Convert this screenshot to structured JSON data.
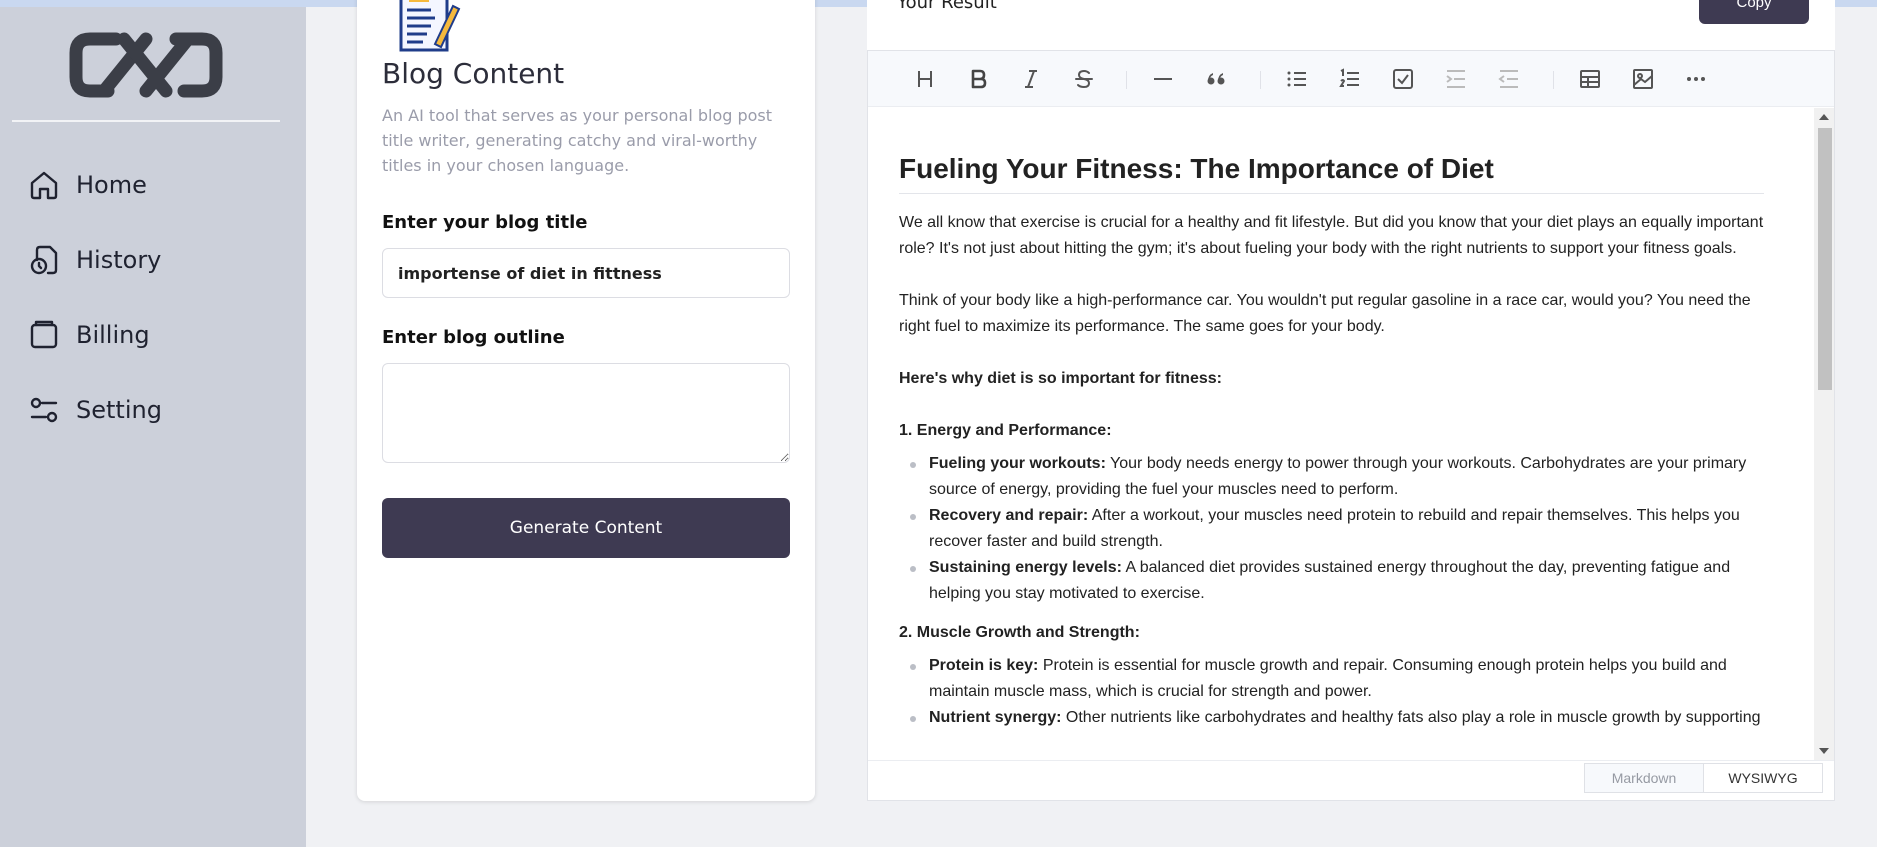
{
  "sidebar": {
    "logo_icon": "chain-link-logo",
    "items": [
      {
        "label": "Home",
        "icon": "home-icon"
      },
      {
        "label": "History",
        "icon": "history-icon"
      },
      {
        "label": "Billing",
        "icon": "wallet-icon"
      },
      {
        "label": "Setting",
        "icon": "sliders-icon"
      }
    ]
  },
  "form": {
    "icon": "blog-writing-icon",
    "title": "Blog Content",
    "description": "An AI tool that serves as your personal blog post title writer, generating catchy and viral-worthy titles in your chosen language.",
    "title_label": "Enter your blog title",
    "title_value": "importense of diet in fittness",
    "outline_label": "Enter blog outline",
    "outline_value": "",
    "submit_label": "Generate Content"
  },
  "editor": {
    "header_title": "Your Result",
    "copy_label": "Copy",
    "toolbar": [
      "heading-icon",
      "bold-icon",
      "italic-icon",
      "strike-icon",
      "hr-icon",
      "quote-icon",
      "bullet-list-icon",
      "ordered-list-icon",
      "task-list-icon",
      "indent-icon",
      "outdent-icon",
      "table-icon",
      "image-icon",
      "more-icon"
    ],
    "doc": {
      "heading": "Fueling Your Fitness: The Importance of Diet",
      "p1": "We all know that exercise is crucial for a healthy and fit lifestyle. But did you know that your diet plays an equally important role? It's not just about hitting the gym; it's about fueling your body with the right nutrients to support your fitness goals.",
      "p2": "Think of your body like a high-performance car. You wouldn't put regular gasoline in a race car, would you? You need the right fuel to maximize its performance. The same goes for your body.",
      "p3": "Here's why diet is so important for fitness:",
      "s1_title": "1. Energy and Performance:",
      "s1_items": [
        {
          "bold": "Fueling your workouts:",
          "text": " Your body needs energy to power through your workouts. Carbohydrates are your primary source of energy, providing the fuel your muscles need to perform."
        },
        {
          "bold": "Recovery and repair:",
          "text": " After a workout, your muscles need protein to rebuild and repair themselves. This helps you recover faster and build strength."
        },
        {
          "bold": "Sustaining energy levels:",
          "text": " A balanced diet provides sustained energy throughout the day, preventing fatigue and helping you stay motivated to exercise."
        }
      ],
      "s2_title": "2. Muscle Growth and Strength:",
      "s2_items": [
        {
          "bold": "Protein is key:",
          "text": " Protein is essential for muscle growth and repair. Consuming enough protein helps you build and maintain muscle mass, which is crucial for strength and power."
        },
        {
          "bold": "Nutrient synergy:",
          "text": " Other nutrients like carbohydrates and healthy fats also play a role in muscle growth by supporting"
        }
      ]
    },
    "modes": {
      "markdown": "Markdown",
      "wysiwyg": "WYSIWYG",
      "active": "WYSIWYG"
    }
  },
  "colors": {
    "sidebar_bg": "#ccd0da",
    "button_bg": "#3e3a52",
    "page_bg": "#f0f1f4"
  }
}
